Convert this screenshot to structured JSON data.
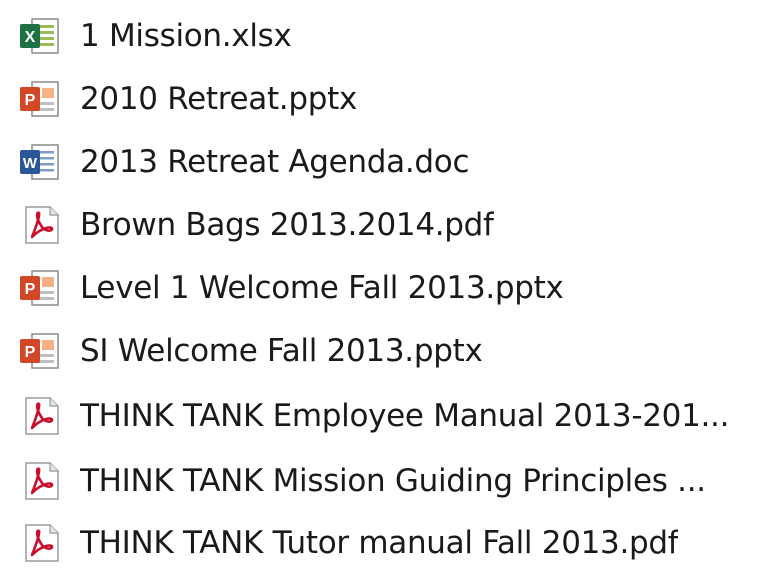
{
  "files": [
    {
      "name": "1 Mission.xlsx",
      "icon": "excel-file-icon"
    },
    {
      "name": "2010 Retreat.pptx",
      "icon": "powerpoint-file-icon"
    },
    {
      "name": "2013 Retreat Agenda.doc",
      "icon": "word-file-icon"
    },
    {
      "name": "Brown Bags 2013.2014.pdf",
      "icon": "pdf-file-icon"
    },
    {
      "name": "Level 1 Welcome Fall 2013.pptx",
      "icon": "powerpoint-file-icon"
    },
    {
      "name": "SI Welcome Fall 2013.pptx",
      "icon": "powerpoint-file-icon"
    },
    {
      "name": "THINK TANK Employee Manual 2013-201...",
      "icon": "pdf-file-icon"
    },
    {
      "name": "THINK TANK Mission Guiding Principles ...",
      "icon": "pdf-file-icon"
    },
    {
      "name": "THINK TANK Tutor manual Fall 2013.pdf",
      "icon": "pdf-file-icon"
    }
  ],
  "colors": {
    "excel": "#1e7145",
    "powerpoint": "#d24726",
    "word": "#2b579a",
    "pdf": "#c8102e"
  }
}
